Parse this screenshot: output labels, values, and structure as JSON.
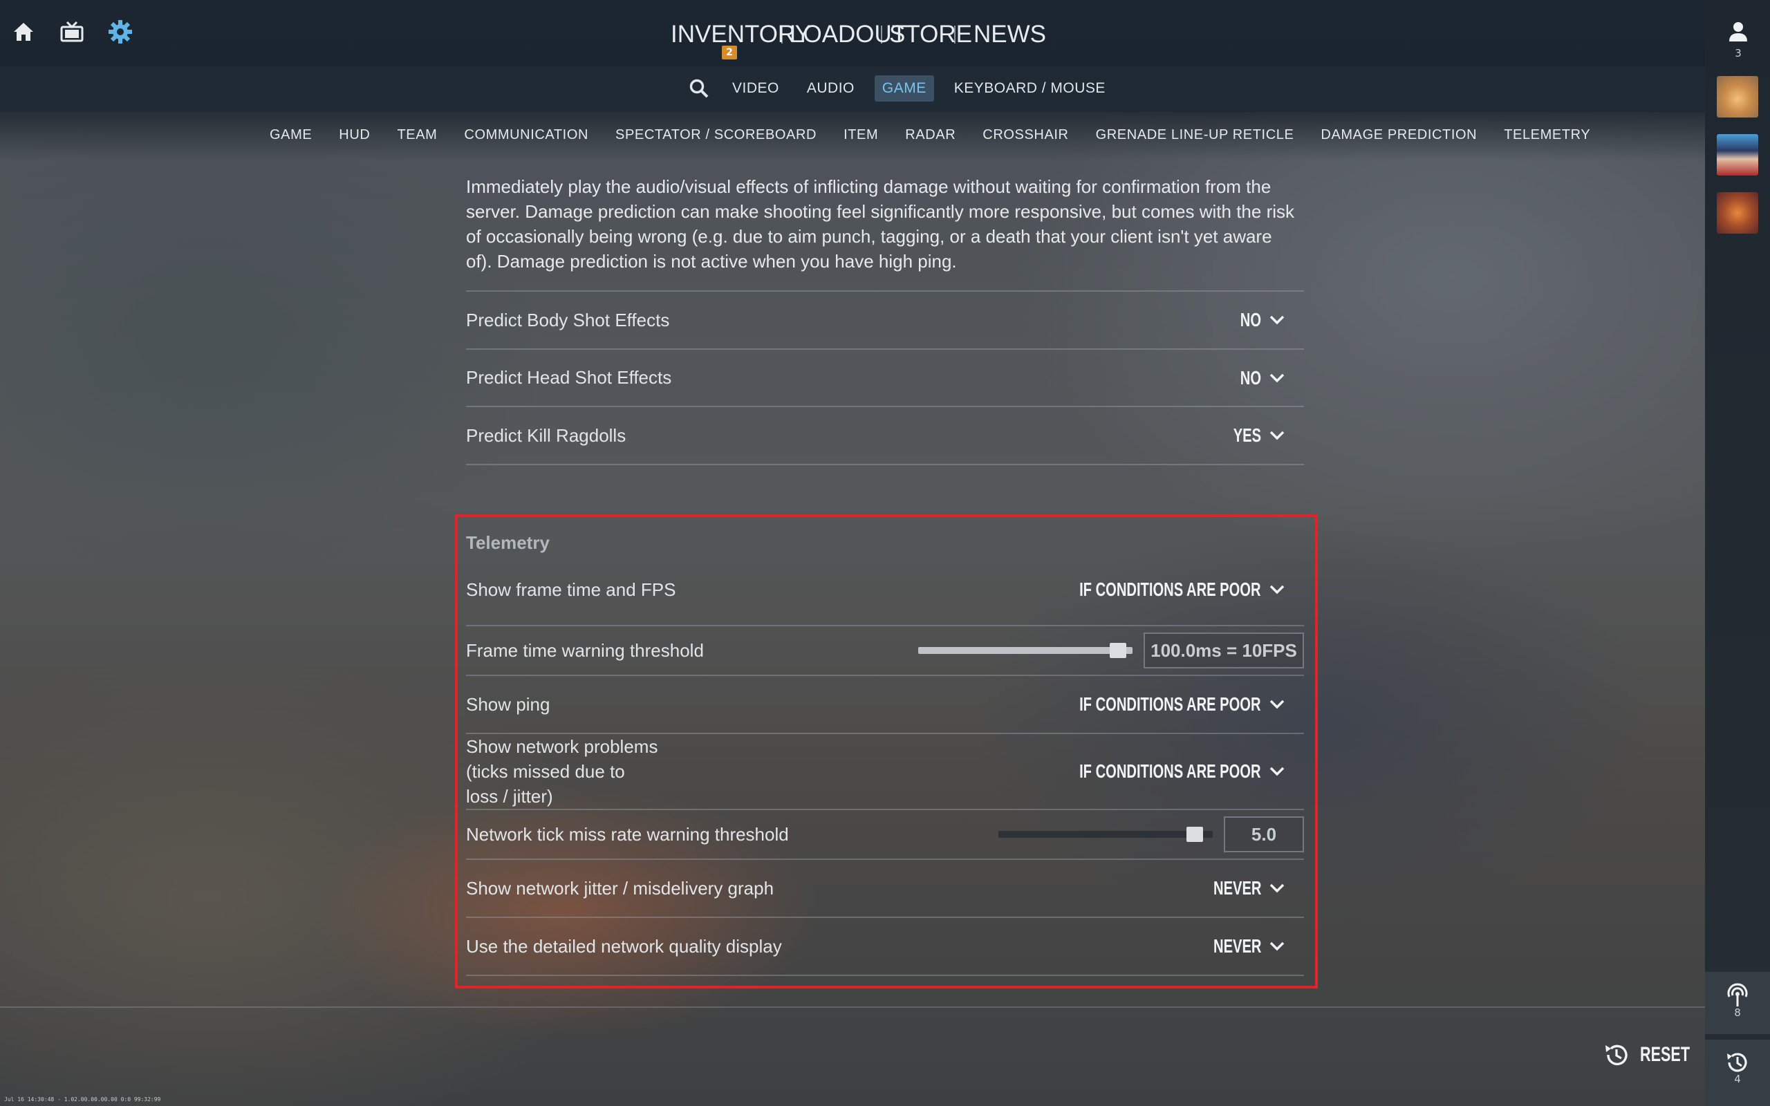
{
  "nav": {
    "items": [
      {
        "label": "INVENTORY",
        "badge": "2"
      },
      {
        "label": "LOADOUT"
      },
      {
        "label": "STORE"
      },
      {
        "label": "NEWS"
      }
    ]
  },
  "settings_tabs": {
    "items": [
      "VIDEO",
      "AUDIO",
      "GAME",
      "KEYBOARD / MOUSE"
    ],
    "active": "GAME"
  },
  "categories": [
    "GAME",
    "HUD",
    "TEAM",
    "COMMUNICATION",
    "SPECTATOR / SCOREBOARD",
    "ITEM",
    "RADAR",
    "CROSSHAIR",
    "GRENADE LINE-UP RETICLE",
    "DAMAGE PREDICTION",
    "TELEMETRY"
  ],
  "damage_prediction": {
    "description": "Immediately play the audio/visual effects of inflicting damage without waiting for confirmation from the server. Damage prediction can make shooting feel significantly more responsive, but comes with the risk of occasionally being wrong (e.g. due to aim punch, tagging, or a death that your client isn't yet aware of). Damage prediction is not active when you have high ping.",
    "rows": [
      {
        "label": "Predict Body Shot Effects",
        "value": "NO"
      },
      {
        "label": "Predict Head Shot Effects",
        "value": "NO"
      },
      {
        "label": "Predict Kill Ragdolls",
        "value": "YES"
      }
    ]
  },
  "telemetry": {
    "title": "Telemetry",
    "rows": [
      {
        "label": "Show frame time and FPS",
        "value": "IF CONDITIONS ARE POOR"
      },
      {
        "label": "Frame time warning threshold",
        "value": "100.0ms = 10FPS",
        "slider_fraction": 0.97
      },
      {
        "label": "Show ping",
        "value": "IF CONDITIONS ARE POOR"
      },
      {
        "label": "Show network problems\n(ticks missed due to\nloss / jitter)",
        "value": "IF CONDITIONS ARE POOR"
      },
      {
        "label": "Network tick miss rate warning threshold",
        "value": "5.0",
        "slider_fraction": 0.95
      },
      {
        "label": "Show network jitter / misdelivery graph",
        "value": "NEVER"
      },
      {
        "label": "Use the detailed network quality display",
        "value": "NEVER"
      }
    ]
  },
  "sidebar": {
    "friends_count": "3",
    "bottom_counts": [
      "8",
      "4"
    ]
  },
  "footer": {
    "reset_label": "RESET",
    "debug_text": "Jul 16 14:30:48 - 1.02.00.00.00.00 0:0 99:32:99"
  },
  "colors": {
    "accent_active": "#7cc2f1",
    "highlight_border": "#e2232a",
    "badge": "#d98a2b"
  }
}
